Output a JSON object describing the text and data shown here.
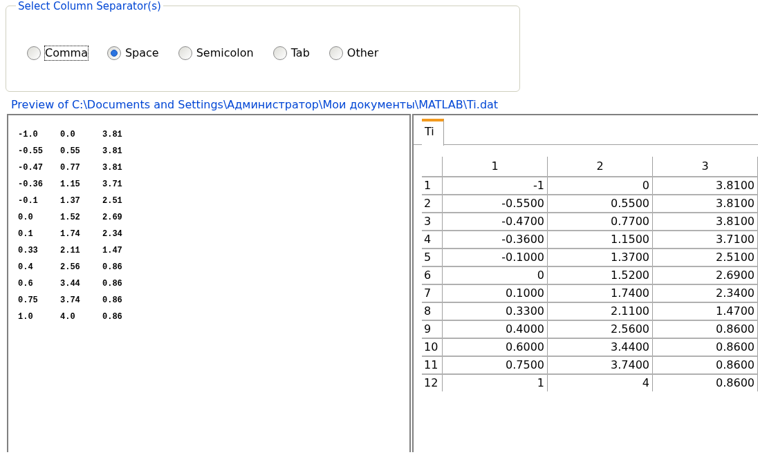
{
  "separator_group": {
    "title": "Select Column Separator(s)",
    "options": [
      {
        "label": "Comma",
        "selected": false,
        "focused": true
      },
      {
        "label": "Space",
        "selected": true,
        "focused": false
      },
      {
        "label": "Semicolon",
        "selected": false,
        "focused": false
      },
      {
        "label": "Tab",
        "selected": false,
        "focused": false
      },
      {
        "label": "Other",
        "selected": false,
        "focused": false
      }
    ]
  },
  "preview_label": "Preview of C:\\Documents and Settings\\Администратор\\Мои документы\\MATLAB\\Ti.dat",
  "raw_text": [
    [
      "-1.0",
      "0.0",
      "3.81"
    ],
    [
      "-0.55",
      "0.55",
      "3.81"
    ],
    [
      "-0.47",
      "0.77",
      "3.81"
    ],
    [
      "-0.36",
      "1.15",
      "3.71"
    ],
    [
      "-0.1",
      "1.37",
      "2.51"
    ],
    [
      "0.0",
      "1.52",
      "2.69"
    ],
    [
      "0.1",
      "1.74",
      "2.34"
    ],
    [
      "0.33",
      "2.11",
      "1.47"
    ],
    [
      "0.4",
      "2.56",
      "0.86"
    ],
    [
      "0.6",
      "3.44",
      "0.86"
    ],
    [
      "0.75",
      "3.74",
      "0.86"
    ],
    [
      "1.0",
      "4.0",
      "0.86"
    ]
  ],
  "tabs": [
    {
      "label": "Ti",
      "selected": true
    }
  ],
  "table": {
    "columns": [
      "1",
      "2",
      "3"
    ],
    "rows": [
      {
        "header": "1",
        "cells": [
          "-1",
          "0",
          "3.8100"
        ]
      },
      {
        "header": "2",
        "cells": [
          "-0.5500",
          "0.5500",
          "3.8100"
        ]
      },
      {
        "header": "3",
        "cells": [
          "-0.4700",
          "0.7700",
          "3.8100"
        ]
      },
      {
        "header": "4",
        "cells": [
          "-0.3600",
          "1.1500",
          "3.7100"
        ]
      },
      {
        "header": "5",
        "cells": [
          "-0.1000",
          "1.3700",
          "2.5100"
        ]
      },
      {
        "header": "6",
        "cells": [
          "0",
          "1.5200",
          "2.6900"
        ]
      },
      {
        "header": "7",
        "cells": [
          "0.1000",
          "1.7400",
          "2.3400"
        ]
      },
      {
        "header": "8",
        "cells": [
          "0.3300",
          "2.1100",
          "1.4700"
        ]
      },
      {
        "header": "9",
        "cells": [
          "0.4000",
          "2.5600",
          "0.8600"
        ]
      },
      {
        "header": "10",
        "cells": [
          "0.6000",
          "3.4400",
          "0.8600"
        ]
      },
      {
        "header": "11",
        "cells": [
          "0.7500",
          "3.7400",
          "0.8600"
        ]
      },
      {
        "header": "12",
        "cells": [
          "1",
          "4",
          "0.8600"
        ]
      }
    ]
  }
}
